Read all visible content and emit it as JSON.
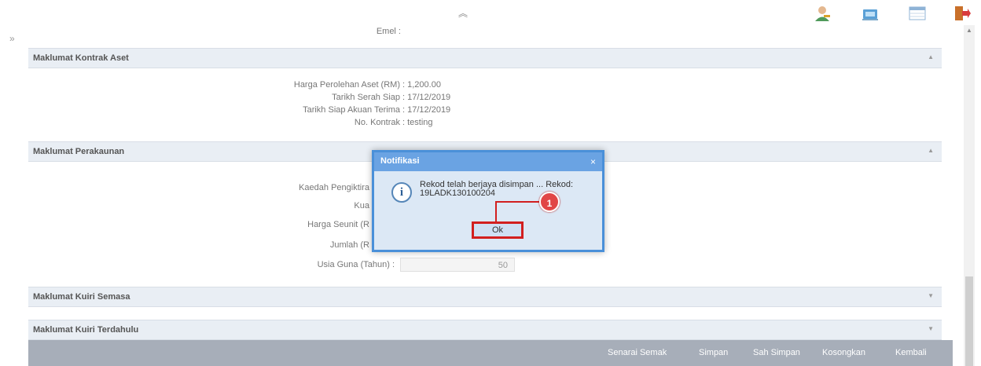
{
  "topbar": {
    "collapse_icon": "double-chevron-up-icon",
    "icons": [
      "user-key-icon",
      "computer-lock-icon",
      "calendar-table-icon",
      "logout-icon"
    ]
  },
  "sidebar": {
    "expand_icon": "double-chevron-right-icon",
    "expand_glyph": "»"
  },
  "email_section": {
    "label": "Emel"
  },
  "sections": {
    "kontrak": {
      "title": "Maklumat Kontrak Aset",
      "fields": [
        {
          "label": "Harga Perolehan Aset (RM)",
          "value": "1,200.00"
        },
        {
          "label": "Tarikh Serah Siap",
          "value": "17/12/2019"
        },
        {
          "label": "Tarikh Siap Akuan Terima",
          "value": "17/12/2019"
        },
        {
          "label": "No. Kontrak",
          "value": "testing"
        }
      ]
    },
    "perakaunan": {
      "title": "Maklumat Perakaunan",
      "fields": [
        {
          "label": "Kaedah Pengiktira",
          "value": ""
        },
        {
          "label": "Kua",
          "value": ""
        },
        {
          "label": "Harga Seunit (R",
          "value": ""
        },
        {
          "label": "Jumlah (R",
          "value": ""
        },
        {
          "label": "Usia Guna (Tahun) :",
          "value": "50"
        }
      ]
    },
    "kuiri_semasa": {
      "title": "Maklumat Kuiri Semasa"
    },
    "kuiri_terdahulu": {
      "title": "Maklumat Kuiri Terdahulu"
    }
  },
  "actions": [
    "Senarai Semak",
    "Simpan",
    "Sah Simpan",
    "Kosongkan",
    "Kembali"
  ],
  "dialog": {
    "title": "Notifikasi",
    "close": "×",
    "message_line1": "Rekod telah berjaya disimpan ... Rekod:",
    "message_line2": "19LADK130100204",
    "ok_label": "Ok",
    "icon": "info-icon"
  },
  "callout": {
    "number": "1"
  },
  "colors": {
    "section_bar": "#e9eef4",
    "action_bar": "#a7aeb9",
    "dialog_header": "#6aa3e3",
    "dialog_body": "#dce8f5",
    "callout_red": "#d21f1f"
  }
}
